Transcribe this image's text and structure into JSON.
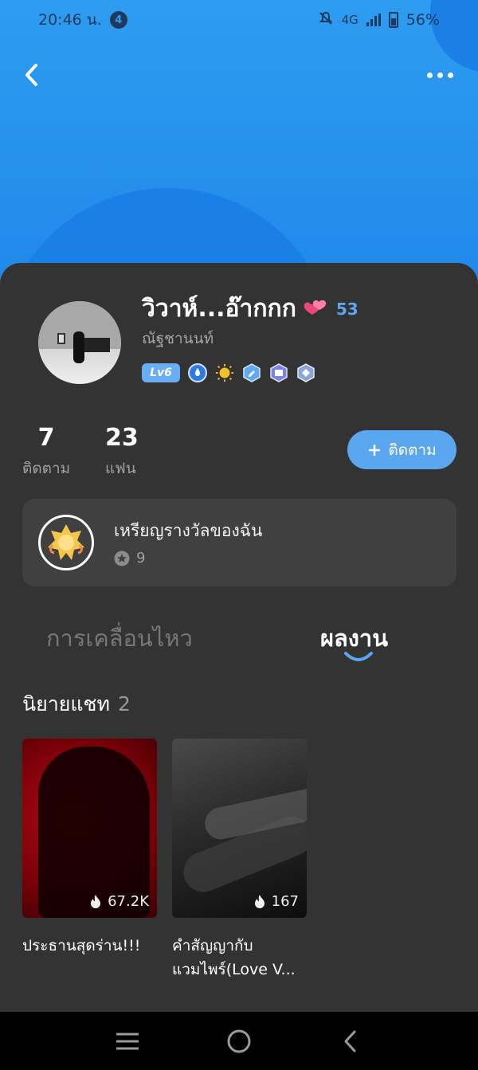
{
  "status_bar": {
    "time": "20:46 น.",
    "notification_count": "4",
    "network": "4G",
    "battery": "56%"
  },
  "profile": {
    "display_name": "วิวาห์...อ๊ากกก",
    "heart_count": "53",
    "username": "ณัฐชานนท์",
    "level": "Lv6"
  },
  "stats": {
    "following_count": "7",
    "following_label": "ติดตาม",
    "fans_count": "23",
    "fans_label": "แฟน"
  },
  "follow_button": {
    "label": "ติดตาม"
  },
  "medals": {
    "title": "เหรียญรางวัลของฉัน",
    "count": "9"
  },
  "tabs": {
    "activity": "การเคลื่อนไหว",
    "works": "ผลงาน"
  },
  "section": {
    "title": "นิยายแชท",
    "count": "2"
  },
  "stories": [
    {
      "title": "ประธานสุดร่าน!!!",
      "views": "67.2K"
    },
    {
      "title": "คำสัญญากับ แวมไพร์(Love V...",
      "views": "167"
    }
  ],
  "colors": {
    "accent": "#5aa7f0",
    "header": "#2e9cf0",
    "sheet": "#333333"
  }
}
